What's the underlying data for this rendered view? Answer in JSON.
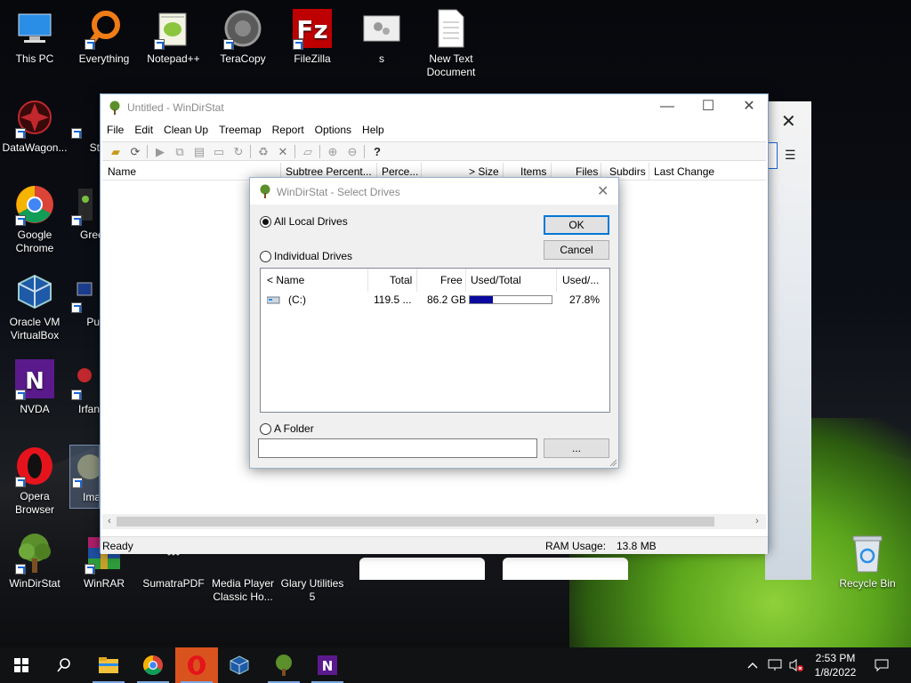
{
  "desktop": {
    "icons": [
      {
        "label": "This PC"
      },
      {
        "label": "Everything"
      },
      {
        "label": "Notepad++"
      },
      {
        "label": "TeraCopy"
      },
      {
        "label": "FileZilla"
      },
      {
        "label": "s"
      },
      {
        "label": "New Text Document"
      },
      {
        "label": "DataWagon..."
      },
      {
        "label": "St"
      },
      {
        "label": "Google Chrome"
      },
      {
        "label": "Gree"
      },
      {
        "label": "Oracle VM VirtualBox"
      },
      {
        "label": "Pu"
      },
      {
        "label": "NVDA"
      },
      {
        "label": "Irfan"
      },
      {
        "label": "Opera Browser"
      },
      {
        "label": "Ima"
      },
      {
        "label": "WinDirStat"
      },
      {
        "label": "WinRAR"
      },
      {
        "label": "SumatraPDF"
      },
      {
        "label": "Media Player Classic Ho..."
      },
      {
        "label": "Glary Utilities 5"
      },
      {
        "label": "Recycle Bin"
      }
    ]
  },
  "main_window": {
    "title": "Untitled - WinDirStat",
    "menu": [
      "File",
      "Edit",
      "Clean Up",
      "Treemap",
      "Report",
      "Options",
      "Help"
    ],
    "columns": [
      "Name",
      "Subtree Percent...",
      "Perce...",
      "> Size",
      "Items",
      "Files",
      "Subdirs",
      "Last Change"
    ],
    "status": {
      "left": "Ready",
      "ram_label": "RAM Usage:",
      "ram_value": "13.8 MB"
    }
  },
  "dialog": {
    "title": "WinDirStat - Select Drives",
    "options": {
      "all_local": "All Local Drives",
      "individual": "Individual Drives",
      "folder": "A Folder"
    },
    "selected_option": "all_local",
    "buttons": {
      "ok": "OK",
      "cancel": "Cancel",
      "browse": "..."
    },
    "list_columns": [
      "< Name",
      "Total",
      "Free",
      "Used/Total",
      "Used/..."
    ],
    "drives": [
      {
        "name": "(C:)",
        "total": "119.5 ...",
        "free": "86.2 GB",
        "used_fraction": 0.278,
        "used_pct": "27.8%"
      }
    ],
    "folder_value": ""
  },
  "taskbar": {
    "apps": [
      "start",
      "search",
      "file-explorer",
      "chrome",
      "opera",
      "virtualbox",
      "windirstat",
      "nvda"
    ],
    "clock": {
      "time": "2:53 PM",
      "date": "1/8/2022"
    }
  },
  "colors": {
    "accent": "#0078d7",
    "usage_bar": "#0a0aa0",
    "opera_red": "#e5141c",
    "nvda_purple": "#5b1a8c",
    "filezilla_red": "#bf0000"
  }
}
